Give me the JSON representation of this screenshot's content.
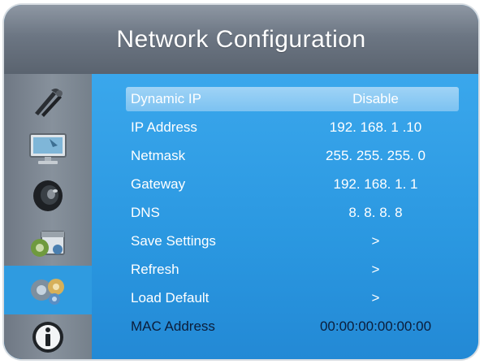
{
  "window": {
    "title": "Network Configuration"
  },
  "sidebar": {
    "items": [
      {
        "icon": "wrench-tools-icon"
      },
      {
        "icon": "monitor-icon"
      },
      {
        "icon": "speaker-icon"
      },
      {
        "icon": "calendar-settings-icon"
      },
      {
        "icon": "network-gears-icon",
        "active": true
      },
      {
        "icon": "info-icon"
      }
    ]
  },
  "menu": {
    "dynamic_ip": {
      "label": "Dynamic IP",
      "value": "Disable"
    },
    "ip_address": {
      "label": "IP Address",
      "value": "192. 168.   1 .10"
    },
    "netmask": {
      "label": "Netmask",
      "value": "255. 255. 255. 0"
    },
    "gateway": {
      "label": "Gateway",
      "value": "192.  168.   1.  1"
    },
    "dns": {
      "label": "DNS",
      "value": "8.    8.    8.  8"
    },
    "save_settings": {
      "label": "Save Settings",
      "value": ">"
    },
    "refresh": {
      "label": "Refresh",
      "value": ">"
    },
    "load_default": {
      "label": "Load Default",
      "value": ">"
    },
    "mac_address": {
      "label": "MAC Address",
      "value": "00:00:00:00:00:00"
    }
  },
  "colors": {
    "accent": "#2f9be0",
    "header": "#6c7683",
    "sidebar": "#87919c",
    "selected_row": "#8ccbf4",
    "mac_text": "#0b1d3a"
  }
}
